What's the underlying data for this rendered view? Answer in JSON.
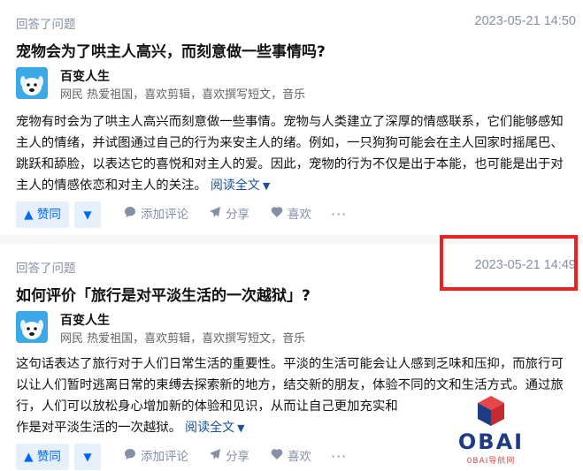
{
  "feed": [
    {
      "action": "回答了问题",
      "time": "2023-05-21 14:50",
      "question": "宠物会为了哄主人高兴，而刻意做一些事情吗?",
      "author": {
        "name": "百变人生",
        "bio": "网民 热爱祖国，喜欢剪辑，喜欢撰写短文，音乐"
      },
      "lines": [
        "宠物有时会为了哄主人高兴而刻意做一些事情。宠物与人类建立了深厚的情感联系，它们能够感知",
        "主人的情绪，并试图通过自己的行为来安主人的绪。例如，一只狗狗可能会在主人回家时摇尾巴、",
        "跳跃和舔脸，以表达它的喜悦和对主人的爱。因此，宠物的行为不仅是出于本能，也可能是出于对",
        "主人的情感依恋和对主人的关注。"
      ],
      "read_more": "阅读全文",
      "upvote": "赞同",
      "comment": "添加评论",
      "share": "分享",
      "like": "喜欢",
      "more": "···"
    },
    {
      "action": "回答了问题",
      "time": "2023-05-21 14:49",
      "question": "如何评价「旅行是对平淡生活的一次越狱」?",
      "author": {
        "name": "百变人生",
        "bio": "网民 热爱祖国，喜欢剪辑，喜欢撰写短文，音乐"
      },
      "lines": [
        "这句话表达了旅行对于人们日常生活的重要性。平淡的生活可能会让人感到乏味和压抑，而旅行可",
        "以让人们暂时逃离日常的束缚去探索新的地方，结交新的朋友，体验不同的文和生活方式。通过旅",
        "行，人们可以放松身心增加新的体验和见识，从而让自己更加充实和",
        "作是对平淡生活的一次越狱。"
      ],
      "read_more": "阅读全文",
      "upvote": "赞同",
      "comment": "添加评论",
      "share": "分享",
      "like": "喜欢",
      "more": "···"
    }
  ],
  "watermark": {
    "text": "OBAI",
    "sub": "0BAI导航网"
  },
  "colors": {
    "accent": "#0066ff",
    "link": "#175199",
    "meta": "#8590a6",
    "highlight_box": "#f02020"
  }
}
